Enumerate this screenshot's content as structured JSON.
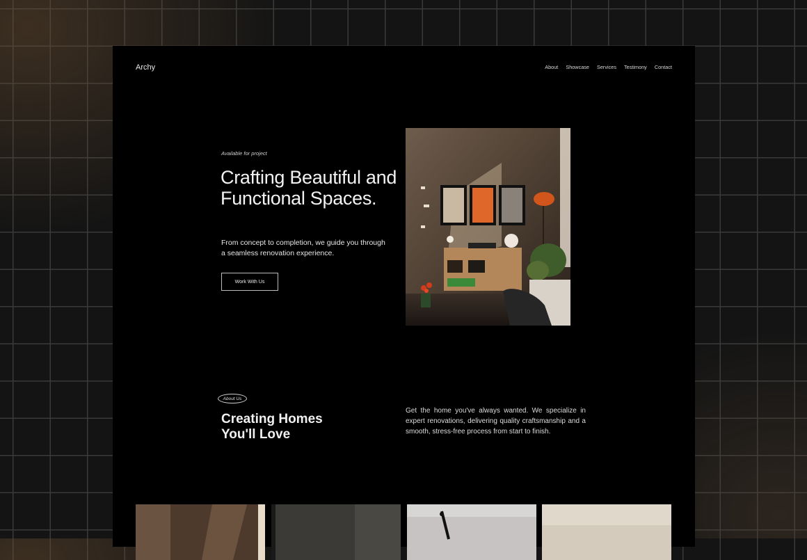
{
  "header": {
    "brand": "Archy",
    "nav": [
      "About",
      "Showcase",
      "Services",
      "Testimony",
      "Contact"
    ]
  },
  "hero": {
    "availability": "Available for project",
    "title": "Crafting Beautiful and Functional Spaces.",
    "subtitle": "From concept to completion, we guide you through a seamless renovation experience.",
    "cta": "Work With Us"
  },
  "about": {
    "tag": "About Us",
    "title": "Creating Homes You'll Love",
    "text": "Get the home you've always wanted. We specialize in expert renovations, delivering quality craftsmanship and a smooth, stress-free process from start to finish."
  },
  "colors": {
    "page": "#000000",
    "accent": "#e0672a",
    "grid_bg": "#141414"
  }
}
